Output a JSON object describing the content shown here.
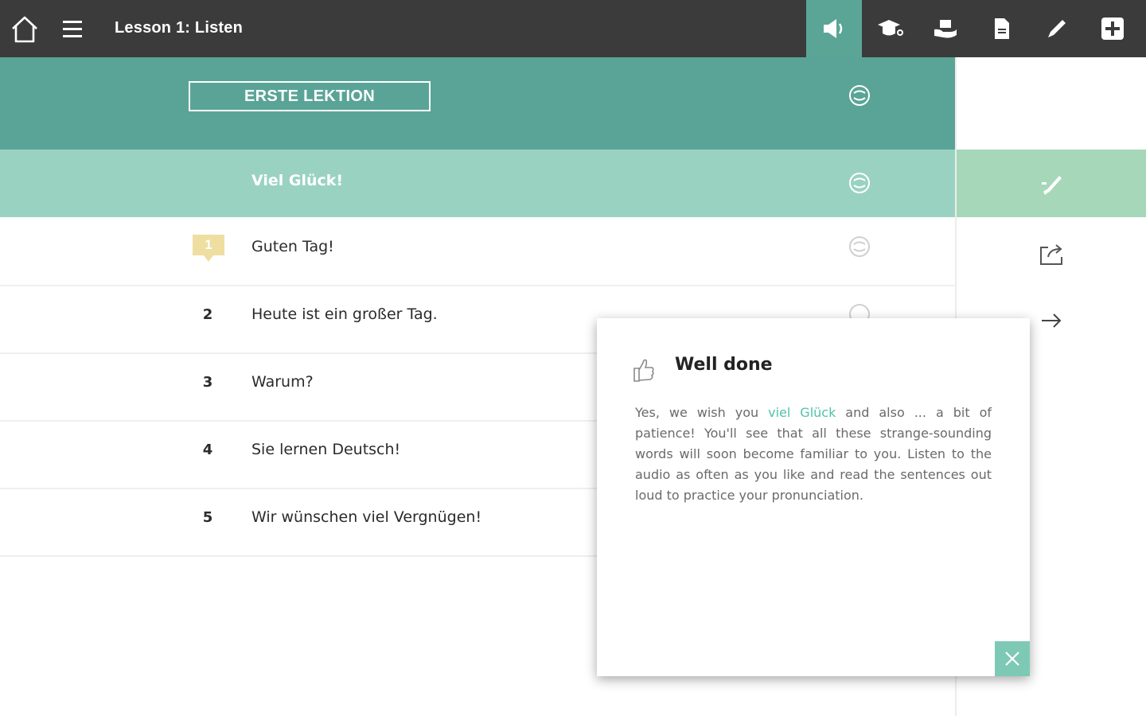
{
  "header": {
    "title": "Lesson 1: Listen",
    "home_icon": "home-icon",
    "menu_icon": "hamburger-menu-icon",
    "tools": [
      {
        "icon": "speaker-icon",
        "active": true
      },
      {
        "icon": "graduation-cap-icon",
        "active": false
      },
      {
        "icon": "hand-holding-icon",
        "active": false
      },
      {
        "icon": "document-icon",
        "active": false
      },
      {
        "icon": "pencil-icon",
        "active": false
      },
      {
        "icon": "plus-square-icon",
        "active": false
      }
    ]
  },
  "lesson": {
    "title": "ERSTE LEKTION",
    "audio_icon": "audio-loop-icon"
  },
  "highlighted_item": {
    "text": "Viel Glück!"
  },
  "sentences": [
    {
      "number": "1",
      "text": "Guten Tag!",
      "badge": true
    },
    {
      "number": "2",
      "text": "Heute ist ein großer Tag.",
      "badge": false
    },
    {
      "number": "3",
      "text": "Warum?",
      "badge": false
    },
    {
      "number": "4",
      "text": "Sie lernen Deutsch!",
      "badge": false
    },
    {
      "number": "5",
      "text": "Wir wünschen viel Vergnügen!",
      "badge": false
    }
  ],
  "side_panel": {
    "buttons": [
      {
        "icon": "pen-brush-icon",
        "active": true
      },
      {
        "icon": "share-export-icon",
        "active": false
      },
      {
        "icon": "arrow-right-icon",
        "active": false
      }
    ]
  },
  "popup": {
    "icon": "thumbs-up-icon",
    "title": "Well done",
    "text_before": "Yes, we wish you ",
    "text_highlight": "viel Glück",
    "text_after": " and also ... a bit of patience! You'll see that all these strange-sounding words will soon become familiar to you. Listen to the audio as often as you like and read the sentences out loud to practice your pronunciation.",
    "close_icon": "close-icon"
  },
  "colors": {
    "topbar": "#3b3b3b",
    "accent": "#5ba597",
    "highlight_row": "#9ad2c1",
    "side_active": "#a6d7b9",
    "badge": "#eedea0",
    "link": "#4fc3a8"
  }
}
